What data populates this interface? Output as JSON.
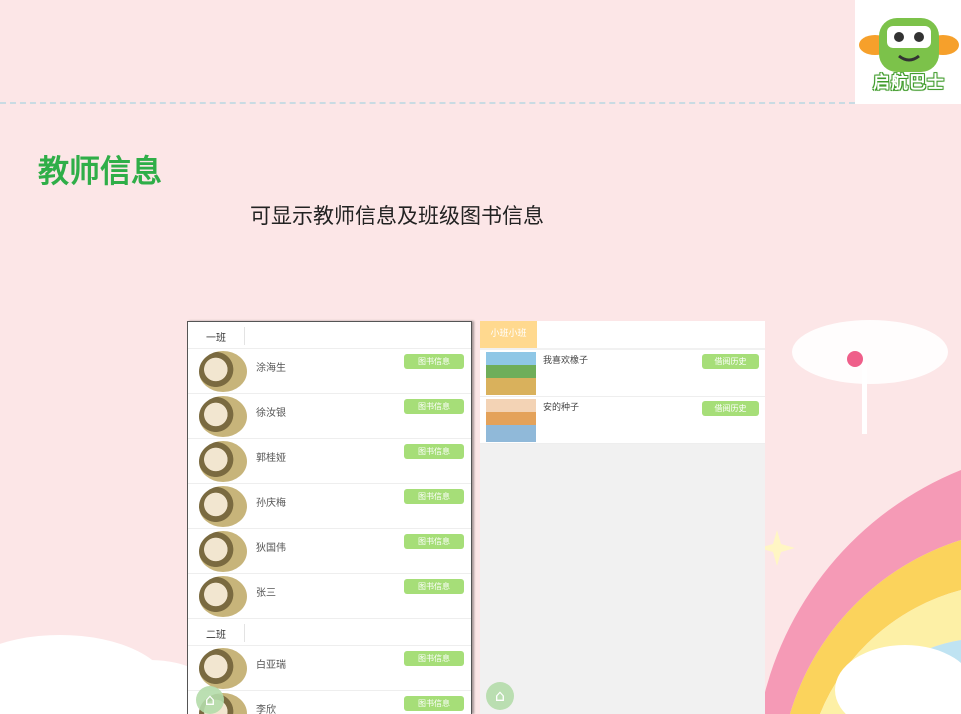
{
  "header": {
    "title": "教师信息",
    "subtitle": "可显示教师信息及班级图书信息",
    "logo_text": "启航巴士"
  },
  "left_panel": {
    "groups": [
      {
        "class_name": "一班",
        "teachers": [
          {
            "name": "涂海生",
            "button": "图书信息"
          },
          {
            "name": "徐汝银",
            "button": "图书信息"
          },
          {
            "name": "郭桂娅",
            "button": "图书信息"
          },
          {
            "name": "孙庆梅",
            "button": "图书信息"
          },
          {
            "name": "狄国伟",
            "button": "图书信息"
          },
          {
            "name": "张三",
            "button": "图书信息"
          }
        ]
      },
      {
        "class_name": "二班",
        "teachers": [
          {
            "name": "白亚瑞",
            "button": "图书信息"
          },
          {
            "name": "李欣",
            "button": "图书信息"
          }
        ]
      }
    ],
    "home_icon": "home-icon"
  },
  "right_panel": {
    "active_tab": "小班小班",
    "books": [
      {
        "title": "我喜欢橡子",
        "button": "借阅历史"
      },
      {
        "title": "安的种子",
        "button": "借阅历史"
      }
    ],
    "home_icon": "home-icon"
  },
  "colors": {
    "background": "#fce6e7",
    "title_green": "#2fae48",
    "button_green": "#a6de78",
    "tab_yellow": "#ffd98f"
  }
}
